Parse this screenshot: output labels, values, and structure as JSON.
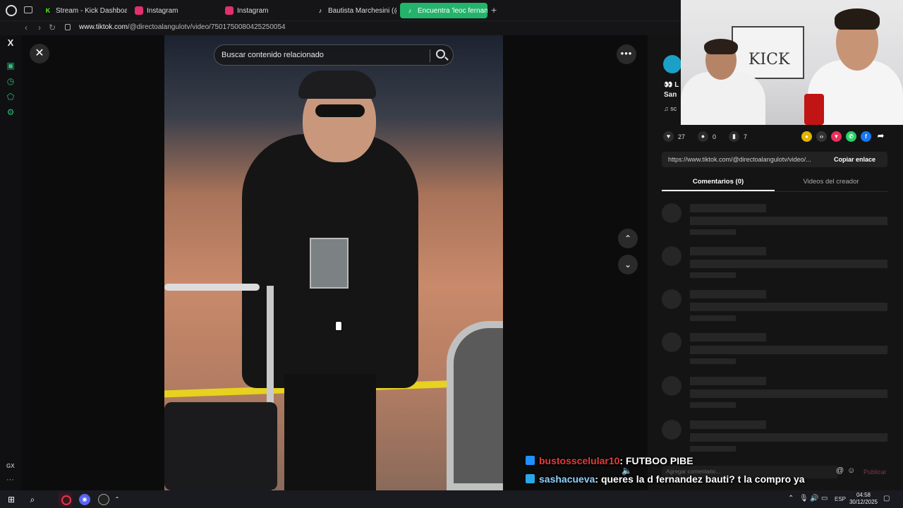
{
  "browser": {
    "tabs": [
      {
        "label": "Stream - Kick Dashboard",
        "icon": "kick-icon",
        "color": "#53fc18"
      },
      {
        "label": "Instagram",
        "icon": "instagram-icon",
        "color": "#e1306c"
      },
      {
        "label": "Instagram",
        "icon": "instagram-icon",
        "color": "#e1306c"
      },
      {
        "label": "Bautista Marchesini (@ba",
        "icon": "tiktok-icon",
        "color": "#ffffff"
      },
      {
        "label": "Encuentra 'leoc fernan",
        "icon": "tiktok-icon",
        "color": "#ffffff"
      }
    ],
    "new_tab": "+",
    "url_domain": "www.tiktok.com",
    "url_path": "/@directoalangulotv/video/7501750080425250054",
    "accent": "#24b36b"
  },
  "video": {
    "search_placeholder": "Buscar contenido relacionado"
  },
  "post": {
    "caption_line1": "👀 L",
    "caption_line2": "San",
    "music": "♫ sc",
    "likes": "27",
    "comments": "0",
    "saves": "7",
    "link": "https://www.tiktok.com/@directoalangulotv/video/...",
    "copy_label": "Copiar enlace",
    "tabs": [
      "Comentarios (0)",
      "Videos del creador"
    ],
    "comment_placeholder": "Agregar comentario...",
    "publish_label": "Publicar"
  },
  "webcam": {
    "board_text": "KICK"
  },
  "chat": [
    {
      "user": "bustosscelular10",
      "message": ": FUTBOO PIBE"
    },
    {
      "user": "sashacueva",
      "message": ": queres la d fernandez bauti? t la compro ya"
    }
  ],
  "sidebar": {
    "gx": "GX"
  },
  "taskbar": {
    "lang": "ESP",
    "time": "04:58",
    "date": "30/12/2025"
  }
}
